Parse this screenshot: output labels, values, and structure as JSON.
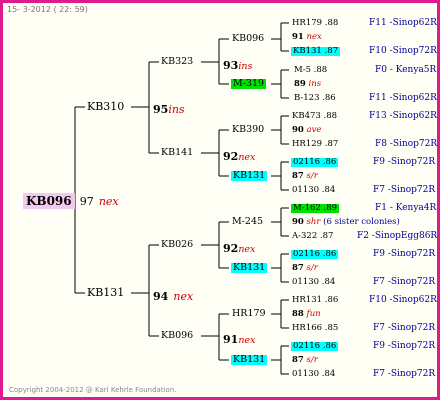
{
  "header": {
    "date": "15- 3-2012 ( 22: 59)"
  },
  "footer": {
    "copyright": "Copyright 2004-2012 @ Karl Kehrle Foundation."
  },
  "root": {
    "id": "KB096",
    "number": "97",
    "tag": "nex"
  },
  "gen1": [
    {
      "id": "KB310",
      "number": "95",
      "tag": "ins"
    },
    {
      "id": "KB131",
      "number": "94",
      "tag": "nex"
    }
  ],
  "gen2": [
    {
      "id": "KB323",
      "number": "93",
      "tag": "ins"
    },
    {
      "id": "KB141",
      "number": "92",
      "tag": "nex"
    },
    {
      "id": "KB026",
      "number": "92",
      "tag": "nex"
    },
    {
      "id": "KB096",
      "number": "91",
      "tag": "nex"
    }
  ],
  "gen3": [
    {
      "id": "KB096"
    },
    {
      "id": "M-319"
    },
    {
      "id": "KB390"
    },
    {
      "id": "KB131"
    },
    {
      "id": "M-245"
    },
    {
      "id": "KB131"
    },
    {
      "id": "HR179"
    },
    {
      "id": "KB131"
    }
  ],
  "gen4": [
    {
      "top": "HR179 .88",
      "number": "91",
      "tag": "nex",
      "bottom": "KB131 .87",
      "src_top": "F11 -Sinop62R",
      "src_bottom": "F10 -Sinop72R"
    },
    {
      "top": "M-5 .88",
      "number": "89",
      "tag": "ins",
      "bottom": "B-123 .86",
      "src_top": "F0 - Kenya5R",
      "src_bottom": "F11 -Sinop62R"
    },
    {
      "top": "KB473 .88",
      "number": "90",
      "tag": "ave",
      "bottom": "HR129 .87",
      "src_top": "F13 -Sinop62R",
      "src_bottom": "F8 -Sinop72R"
    },
    {
      "top": "02116 .86",
      "number": "87",
      "tag": "s/r",
      "bottom": "01130 .84",
      "src_top": "F9 -Sinop72R",
      "src_bottom": "F7 -Sinop72R"
    },
    {
      "top": "M-162 .89",
      "number": "90",
      "tag": "shr",
      "note": "(6 sister colonies)",
      "bottom": "A-322 .87",
      "src_top": "F1 - Kenya4R",
      "src_bottom": "F2 -SinopEgg86R"
    },
    {
      "top": "02116 .86",
      "number": "87",
      "tag": "s/r",
      "bottom": "01130 .84",
      "src_top": "F9 -Sinop72R",
      "src_bottom": "F7 -Sinop72R"
    },
    {
      "top": "HR131 .86",
      "number": "88",
      "tag": "fun",
      "bottom": "HR166 .85",
      "src_top": "F10 -Sinop62R",
      "src_bottom": "F7 -Sinop72R"
    },
    {
      "top": "02116 .86",
      "number": "87",
      "tag": "s/r",
      "bottom": "01130 .84",
      "src_top": "F9 -Sinop72R",
      "src_bottom": "F7 -Sinop72R"
    }
  ]
}
